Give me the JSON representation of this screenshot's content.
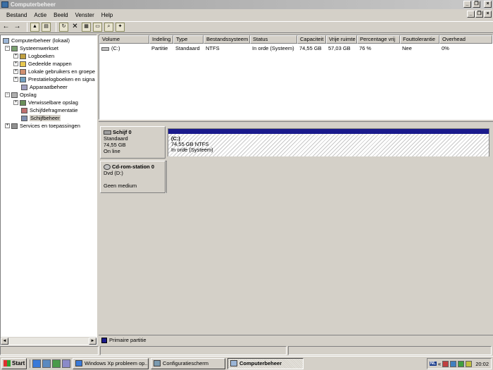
{
  "window": {
    "title": "Computerbeheer"
  },
  "menu": [
    "Bestand",
    "Actie",
    "Beeld",
    "Venster",
    "Help"
  ],
  "tree": {
    "root": "Computerbeheer (lokaal)",
    "system_tools": "Systeemwerkset",
    "event_logs": "Logboeken",
    "shared_folders": "Gedeelde mappen",
    "local_users": "Lokale gebruikers en groepe",
    "perf_logs": "Prestatielogboeken en signa",
    "device_manager": "Apparaatbeheer",
    "storage": "Opslag",
    "removable": "Verwisselbare opslag",
    "defrag": "Schijfdefragmentatie",
    "disk_mgmt": "Schijfbeheer",
    "services": "Services en toepassingen"
  },
  "volumes": {
    "headers": [
      "Volume",
      "Indeling",
      "Type",
      "Bestandssysteem",
      "Status",
      "Capaciteit",
      "Vrije ruimte",
      "Percentage vrij",
      "Fouttolerantie",
      "Overhead"
    ],
    "row": [
      "(C:)",
      "Partitie",
      "Standaard",
      "NTFS",
      "In orde (Systeem)",
      "74,55 GB",
      "57,03 GB",
      "76 %",
      "Nee",
      "0%"
    ]
  },
  "disk0": {
    "name": "Schijf 0",
    "type": "Standaard",
    "size": "74,55 GB",
    "state": "On line",
    "partition_name": "(C:)",
    "partition_size": "74,55 GB NTFS",
    "partition_status": "In orde (Systeem)"
  },
  "cdrom0": {
    "name": "Cd-rom-station 0",
    "type": "Dvd (D:)",
    "state": "Geen medium"
  },
  "legend": {
    "primary": "Primaire partitie"
  },
  "taskbar": {
    "start": "Start",
    "tasks": [
      "Windows Xp probleem op...",
      "Configuratiescherm",
      "Computerbeheer"
    ],
    "lang": "NL",
    "clock": "20:02"
  }
}
